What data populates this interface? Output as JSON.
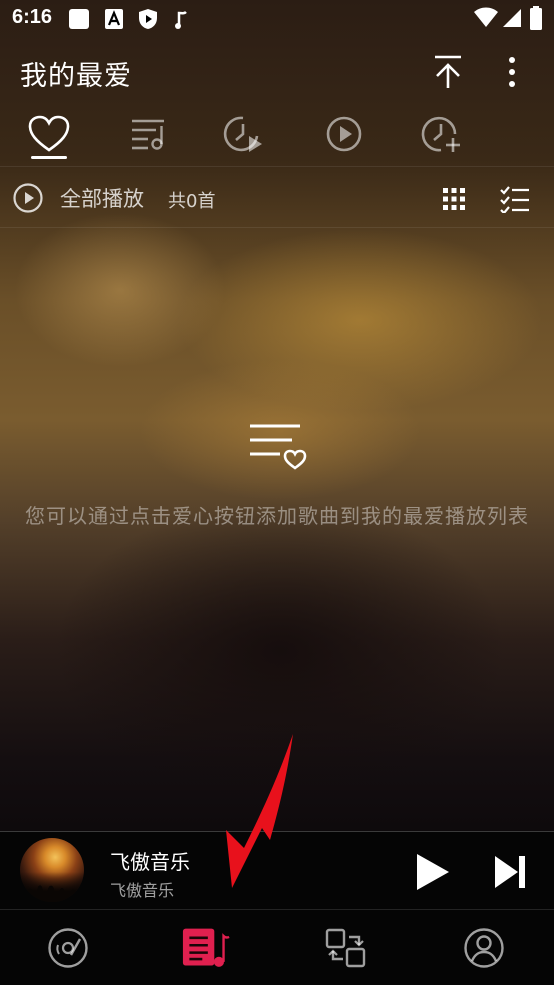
{
  "status_bar": {
    "time": "6:16",
    "icons": [
      "notification-square-icon",
      "font-a-icon",
      "shield-play-icon",
      "music-note-icon",
      "wifi-icon",
      "signal-icon",
      "battery-icon"
    ]
  },
  "header": {
    "title": "我的最爱",
    "icons": [
      "scroll-to-top-icon",
      "more-vertical-icon"
    ]
  },
  "tabs": [
    {
      "icon": "heart-icon",
      "selected": true
    },
    {
      "icon": "playlist-music-icon",
      "selected": false
    },
    {
      "icon": "recent-play-icon",
      "selected": false
    },
    {
      "icon": "play-circle-icon",
      "selected": false
    },
    {
      "icon": "add-recent-icon",
      "selected": false
    }
  ],
  "play_row": {
    "play_all": "全部播放",
    "count": "共0首",
    "icons": [
      "grid-view-icon",
      "multi-select-icon"
    ]
  },
  "empty_state": {
    "icon": "playlist-heart-icon",
    "message": "您可以通过点击爱心按钮添加歌曲到我的最爱播放列表"
  },
  "mini_player": {
    "title": "飞傲音乐",
    "artist": "飞傲音乐",
    "icons": [
      "play-icon",
      "skip-next-icon"
    ]
  },
  "bottom_nav": [
    {
      "icon": "disc-icon",
      "selected": false
    },
    {
      "icon": "music-library-icon",
      "selected": true
    },
    {
      "icon": "switch-device-icon",
      "selected": false
    },
    {
      "icon": "profile-icon",
      "selected": false
    }
  ],
  "colors": {
    "accent": "#e0204f",
    "arrow": "#e8111c"
  }
}
